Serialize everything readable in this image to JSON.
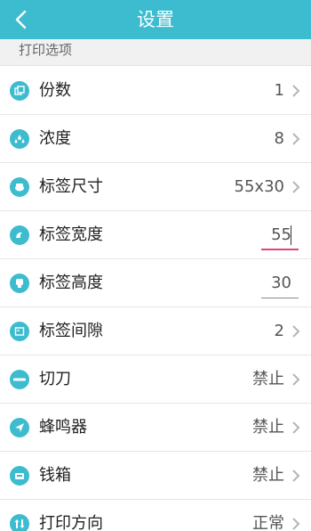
{
  "header": {
    "title": "设置",
    "back_icon": "chevron-left-icon"
  },
  "section": {
    "label": "打印选项"
  },
  "colors": {
    "accent": "#3dbcd0",
    "focus_underline": "#e0457a"
  },
  "rows": [
    {
      "icon": "copies-icon",
      "label": "份数",
      "value": "1",
      "kind": "chevron"
    },
    {
      "icon": "density-icon",
      "label": "浓度",
      "value": "8",
      "kind": "chevron"
    },
    {
      "icon": "label-size-icon",
      "label": "标签尺寸",
      "value": "55x30",
      "kind": "chevron"
    },
    {
      "icon": "label-width-icon",
      "label": "标签宽度",
      "value": "55",
      "kind": "input-active"
    },
    {
      "icon": "label-height-icon",
      "label": "标签高度",
      "value": "30",
      "kind": "input"
    },
    {
      "icon": "label-gap-icon",
      "label": "标签间隙",
      "value": "2",
      "kind": "chevron"
    },
    {
      "icon": "cutter-icon",
      "label": "切刀",
      "value": "禁止",
      "kind": "chevron"
    },
    {
      "icon": "buzzer-icon",
      "label": "蜂鸣器",
      "value": "禁止",
      "kind": "chevron"
    },
    {
      "icon": "cash-drawer-icon",
      "label": "钱箱",
      "value": "禁止",
      "kind": "chevron"
    },
    {
      "icon": "print-direction-icon",
      "label": "打印方向",
      "value": "正常",
      "kind": "chevron"
    }
  ]
}
